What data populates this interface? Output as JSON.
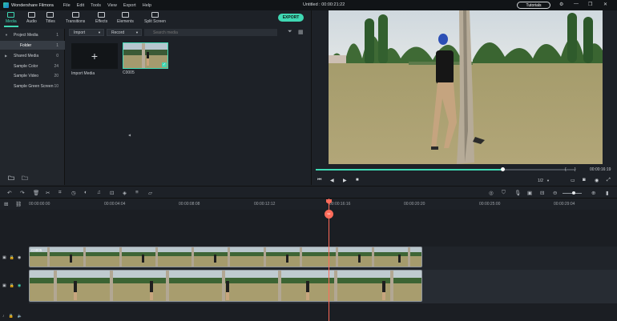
{
  "app": {
    "name": "Wondershare Filmora",
    "menus": [
      "File",
      "Edit",
      "Tools",
      "View",
      "Export",
      "Help"
    ],
    "document_title": "Untitled : 00:00:21:22",
    "tutorials_label": "Tutorials",
    "window_buttons": [
      "⚙",
      "―",
      "❐",
      "✕"
    ]
  },
  "toolbar": {
    "tabs": [
      "Media",
      "Audio",
      "Titles",
      "Transitions",
      "Effects",
      "Elements",
      "Split Screen"
    ],
    "active_tab": "Media",
    "export_label": "EXPORT"
  },
  "sidebar": {
    "items": [
      {
        "label": "Project Media",
        "count": "1",
        "expandable": true
      },
      {
        "label": "Folder",
        "count": "1",
        "selected": true
      },
      {
        "label": "Shared Media",
        "count": "0",
        "expandable": true
      },
      {
        "label": "Sample Color",
        "count": "24"
      },
      {
        "label": "Sample Video",
        "count": "20"
      },
      {
        "label": "Sample Green Screen",
        "count": "10"
      }
    ]
  },
  "media": {
    "import_select": "Import",
    "record_select": "Record",
    "search_placeholder": "Search media",
    "import_tile_icon": "+",
    "import_tile_label": "Import Media",
    "clip_label": "C0005"
  },
  "preview": {
    "playback_progress": 0.72,
    "current_time": "00:00:16:19",
    "quality": "1/2",
    "brace_left": "{",
    "brace_right": "}"
  },
  "timeline": {
    "ruler_labels": [
      "00:00:00:00",
      "00:00:04:04",
      "00:00:08:08",
      "00:00:12:12",
      "00:00:16:16",
      "00:00:20:20",
      "00:00:25:00",
      "00:00:29:04"
    ],
    "playhead_time_fraction": 0.574,
    "track1_clip_label": "C0005",
    "colors": {
      "accent": "#3fd8b3",
      "playhead": "#ff6b5a"
    }
  }
}
